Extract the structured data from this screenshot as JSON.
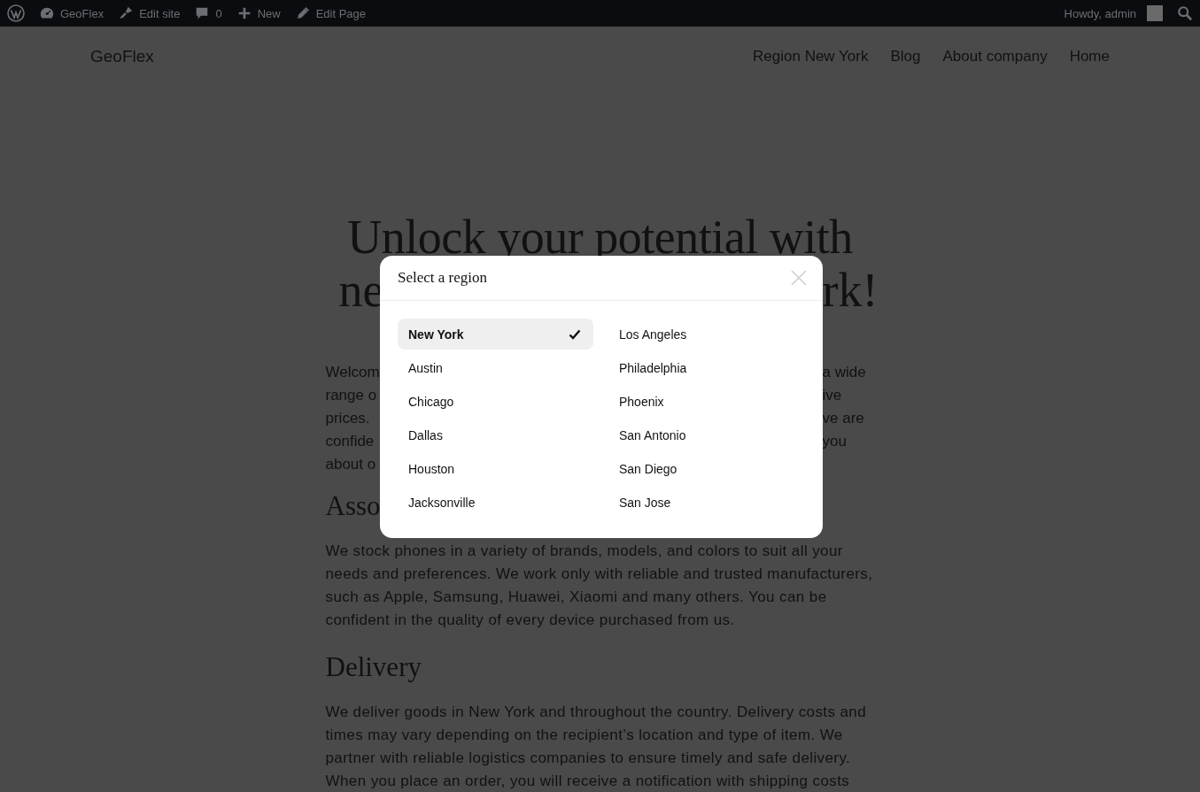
{
  "admin_bar": {
    "items": [
      {
        "kind": "wp-logo"
      },
      {
        "kind": "site",
        "label": "GeoFlex"
      },
      {
        "kind": "edit-site",
        "label": "Edit site"
      },
      {
        "kind": "comments",
        "label": "0"
      },
      {
        "kind": "new",
        "label": "New"
      },
      {
        "kind": "edit-page",
        "label": "Edit Page"
      }
    ],
    "greeting": "Howdy, admin"
  },
  "header": {
    "logo": "GeoFlex",
    "nav": [
      "Region New York",
      "Blog",
      "About company",
      "Home"
    ]
  },
  "hero": {
    "title_line": "Unlock your potential with",
    "title_fragments": {
      "left": "ne",
      "right": "rk!"
    }
  },
  "intro_fragments": [
    {
      "left": "Welcom",
      "right": "a wide"
    },
    {
      "left": "range o",
      "right": "ive"
    },
    {
      "left": "prices.",
      "right": "ve are"
    },
    {
      "left": "confide",
      "right": "you"
    },
    {
      "left": "about o"
    }
  ],
  "section_heading_fragment": "Asso",
  "sections": [
    {
      "kind": "paragraph",
      "text": "We stock phones in a variety of brands, models, and colors to suit all your needs and preferences. We work only with reliable and trusted manufacturers, such as Apple, Samsung, Huawei, Xiaomi and many others. You can be confident in the quality of every device purchased from us."
    },
    {
      "kind": "heading",
      "text": "Delivery"
    },
    {
      "kind": "paragraph",
      "text": "We deliver goods in New York and throughout the country. Delivery costs and times may vary depending on the recipient’s location and type of item. We partner with reliable logistics companies to ensure timely and safe delivery. When you place an order, you will receive a notification with shipping costs"
    }
  ],
  "modal": {
    "title": "Select a region",
    "regions": [
      {
        "name": "New York",
        "selected": true
      },
      {
        "name": "Austin",
        "selected": false
      },
      {
        "name": "Chicago",
        "selected": false
      },
      {
        "name": "Dallas",
        "selected": false
      },
      {
        "name": "Houston",
        "selected": false
      },
      {
        "name": "Jacksonville",
        "selected": false
      },
      {
        "name": "Los Angeles",
        "selected": false
      },
      {
        "name": "Philadelphia",
        "selected": false
      },
      {
        "name": "Phoenix",
        "selected": false
      },
      {
        "name": "San Antonio",
        "selected": false
      },
      {
        "name": "San Diego",
        "selected": false
      },
      {
        "name": "San Jose",
        "selected": false
      }
    ]
  }
}
